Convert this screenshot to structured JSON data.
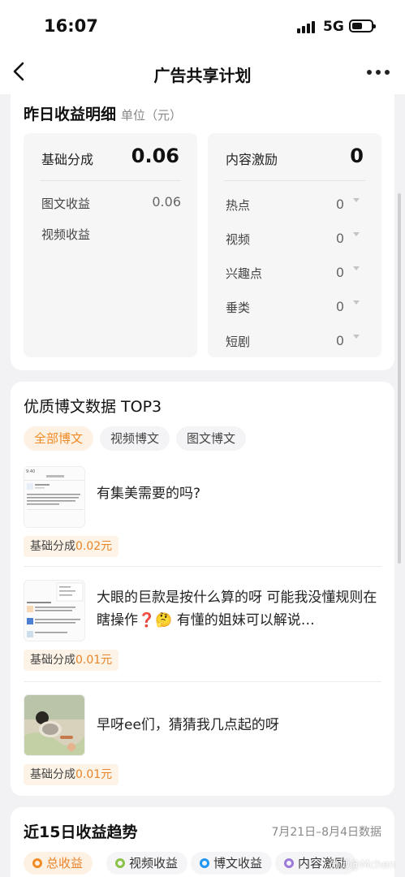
{
  "status_bar": {
    "time": "16:07",
    "network": "5G"
  },
  "nav": {
    "title": "广告共享计划"
  },
  "yesterday": {
    "title": "昨日收益明细",
    "unit": "单位（元）",
    "basic": {
      "label": "基础分成",
      "value": "0.06",
      "rows": [
        {
          "label": "图文收益",
          "value": "0.06"
        },
        {
          "label": "视频收益",
          "value": ""
        }
      ]
    },
    "incentive": {
      "label": "内容激励",
      "value": "0",
      "rows": [
        {
          "label": "热点",
          "value": "0"
        },
        {
          "label": "视频",
          "value": "0"
        },
        {
          "label": "兴趣点",
          "value": "0"
        },
        {
          "label": "垂类",
          "value": "0"
        },
        {
          "label": "短剧",
          "value": "0"
        }
      ]
    }
  },
  "top3": {
    "title": "优质博文数据 TOP3",
    "tabs": [
      "全部博文",
      "视频博文",
      "图文博文"
    ],
    "active_tab": "全部博文",
    "posts": [
      {
        "text": "有集美需要的吗?",
        "badge_label": "基础分成",
        "badge_value": "0.02元",
        "thumb_icon": "screenshot-thumbnail"
      },
      {
        "text": "大眼的巨款是按什么算的呀 可能我没懂规则在瞎操作❓🤔 有懂的姐妹可以解说…",
        "badge_label": "基础分成",
        "badge_value": "0.01元",
        "thumb_icon": "screenshot-thumbnail"
      },
      {
        "text": "早呀ee们，猜猜我几点起的呀",
        "badge_label": "基础分成",
        "badge_value": "0.01元",
        "thumb_icon": "baby-photo-thumbnail"
      }
    ]
  },
  "trend": {
    "title": "近15日收益趋势",
    "date_range": "7月21日–8月4日数据",
    "legend": [
      {
        "label": "总收益",
        "color": "#f08a24",
        "active": true
      },
      {
        "label": "视频收益",
        "color": "#8bc34a",
        "active": false
      },
      {
        "label": "博文收益",
        "color": "#2196f3",
        "active": false
      },
      {
        "label": "内容激励",
        "color": "#9c7bd8",
        "active": false
      }
    ]
  },
  "watermark": "微博@Mchen"
}
